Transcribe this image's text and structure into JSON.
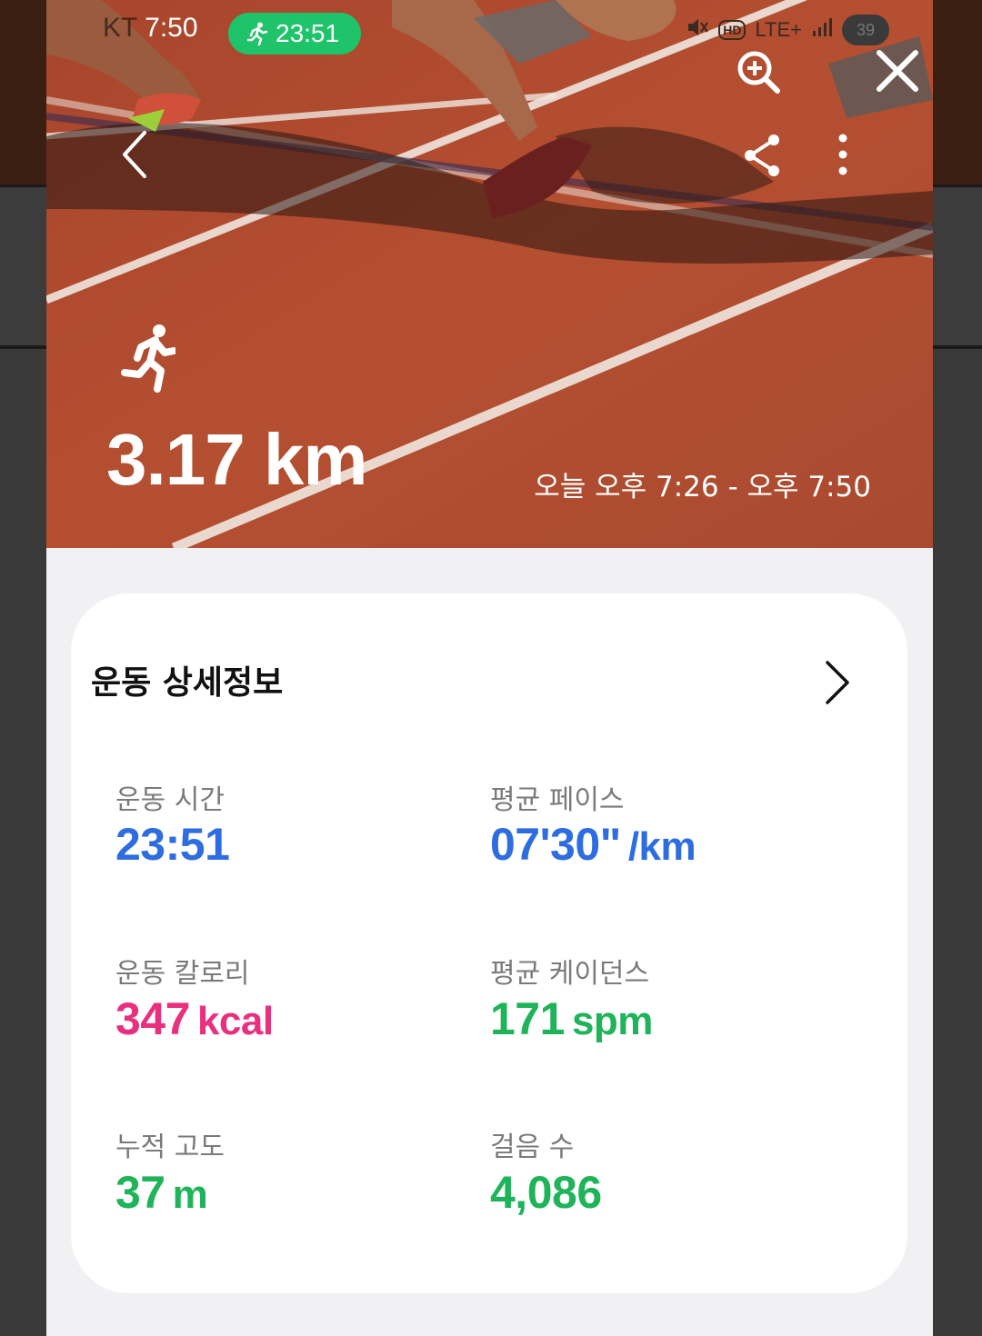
{
  "status_bar": {
    "carrier": "KT",
    "time": "7:50",
    "workout_timer": "23:51",
    "hd": "HD",
    "network": "LTE+",
    "battery": "39",
    "pill_color": "#1fc36a"
  },
  "toolbar": {
    "back_icon": "chevron-left-icon",
    "share_icon": "share-icon",
    "more_icon": "more-vertical-icon",
    "zoom_icon": "zoom-in-icon",
    "close_icon": "close-icon"
  },
  "summary": {
    "activity_icon": "running-person-icon",
    "distance": "3.17 km",
    "time_range": "오늘 오후 7:26 - 오후 7:50"
  },
  "details": {
    "title": "운동 상세정보",
    "stats": [
      {
        "label": "운동 시간",
        "value": "23:51",
        "unit": "",
        "color": "#2e6de0"
      },
      {
        "label": "평균 페이스",
        "value": "07'30\"",
        "unit": "/km",
        "color": "#2e6de0"
      },
      {
        "label": "운동 칼로리",
        "value": "347",
        "unit": "kcal",
        "color": "#e8307f"
      },
      {
        "label": "평균 케이던스",
        "value": "171",
        "unit": "spm",
        "color": "#1fb35a"
      },
      {
        "label": "누적 고도",
        "value": "37",
        "unit": "m",
        "color": "#1fb35a"
      },
      {
        "label": "걸음 수",
        "value": "4,086",
        "unit": "",
        "color": "#1fb35a"
      }
    ]
  }
}
